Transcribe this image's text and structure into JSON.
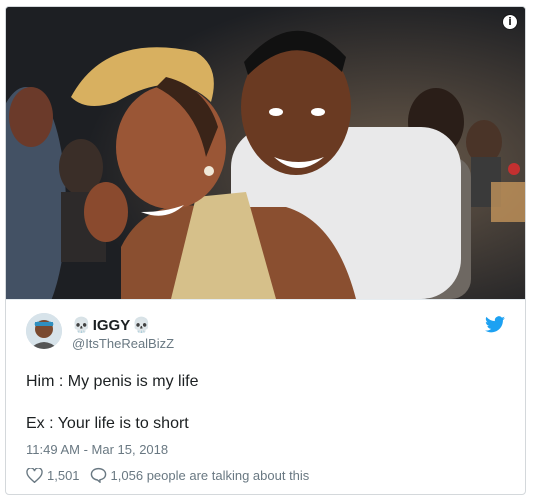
{
  "tweet": {
    "author_name": "IGGY",
    "author_emoji_left": "💀",
    "author_emoji_right": "💀",
    "handle": "@ItsTheRealBizZ",
    "line1": "Him : My penis is my life",
    "line2": "Ex : Your life is to short",
    "timestamp": "11:49 AM - Mar 15, 2018",
    "likes": "1,501",
    "talking": "1,056 people are talking about this"
  },
  "media": {
    "info_icon": "info-icon",
    "description_icons": [
      "woman-laughing",
      "man-smiling"
    ]
  },
  "colors": {
    "twitter_blue": "#1da1f2",
    "text_primary": "#1c2022",
    "text_secondary": "#697882",
    "border": "#d4d8db"
  },
  "icons": {
    "brand": "twitter-bird-icon",
    "like": "heart-icon",
    "reply": "speech-bubble-icon"
  }
}
